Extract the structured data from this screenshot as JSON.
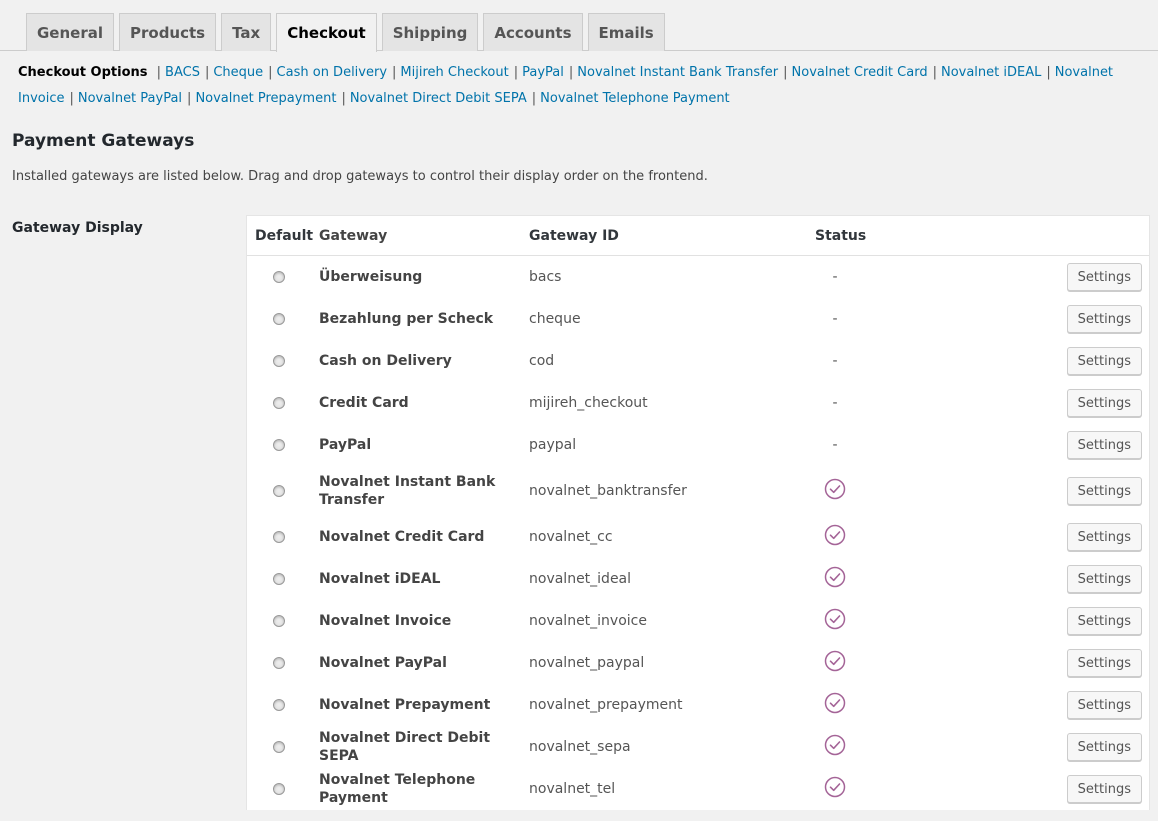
{
  "tabs": [
    {
      "label": "General",
      "active": false
    },
    {
      "label": "Products",
      "active": false
    },
    {
      "label": "Tax",
      "active": false
    },
    {
      "label": "Checkout",
      "active": true
    },
    {
      "label": "Shipping",
      "active": false
    },
    {
      "label": "Accounts",
      "active": false
    },
    {
      "label": "Emails",
      "active": false
    }
  ],
  "subnav": {
    "current": "Checkout Options",
    "links": [
      "BACS",
      "Cheque",
      "Cash on Delivery",
      "Mijireh Checkout",
      "PayPal",
      "Novalnet Instant Bank Transfer",
      "Novalnet Credit Card",
      "Novalnet iDEAL",
      "Novalnet Invoice",
      "Novalnet PayPal",
      "Novalnet Prepayment",
      "Novalnet Direct Debit SEPA",
      "Novalnet Telephone Payment"
    ]
  },
  "heading": "Payment Gateways",
  "description": "Installed gateways are listed below. Drag and drop gateways to control their display order on the frontend.",
  "gateway_display_label": "Gateway Display",
  "table": {
    "headers": {
      "default": "Default",
      "gateway": "Gateway",
      "gateway_id": "Gateway ID",
      "status": "Status"
    },
    "settings_label": "Settings",
    "status_colors": {
      "enabled": "#a46497"
    },
    "rows": [
      {
        "name": "Überweisung",
        "id": "bacs",
        "status": "-",
        "enabled": false
      },
      {
        "name": "Bezahlung per Scheck",
        "id": "cheque",
        "status": "-",
        "enabled": false
      },
      {
        "name": "Cash on Delivery",
        "id": "cod",
        "status": "-",
        "enabled": false
      },
      {
        "name": "Credit Card",
        "id": "mijireh_checkout",
        "status": "-",
        "enabled": false
      },
      {
        "name": "PayPal",
        "id": "paypal",
        "status": "-",
        "enabled": false
      },
      {
        "name": "Novalnet Instant Bank Transfer",
        "id": "novalnet_banktransfer",
        "status": "",
        "enabled": true
      },
      {
        "name": "Novalnet Credit Card",
        "id": "novalnet_cc",
        "status": "",
        "enabled": true
      },
      {
        "name": "Novalnet iDEAL",
        "id": "novalnet_ideal",
        "status": "",
        "enabled": true
      },
      {
        "name": "Novalnet Invoice",
        "id": "novalnet_invoice",
        "status": "",
        "enabled": true
      },
      {
        "name": "Novalnet PayPal",
        "id": "novalnet_paypal",
        "status": "",
        "enabled": true
      },
      {
        "name": "Novalnet Prepayment",
        "id": "novalnet_prepayment",
        "status": "",
        "enabled": true
      },
      {
        "name": "Novalnet Direct Debit SEPA",
        "id": "novalnet_sepa",
        "status": "",
        "enabled": true
      },
      {
        "name": "Novalnet Telephone Payment",
        "id": "novalnet_tel",
        "status": "",
        "enabled": true
      }
    ]
  }
}
